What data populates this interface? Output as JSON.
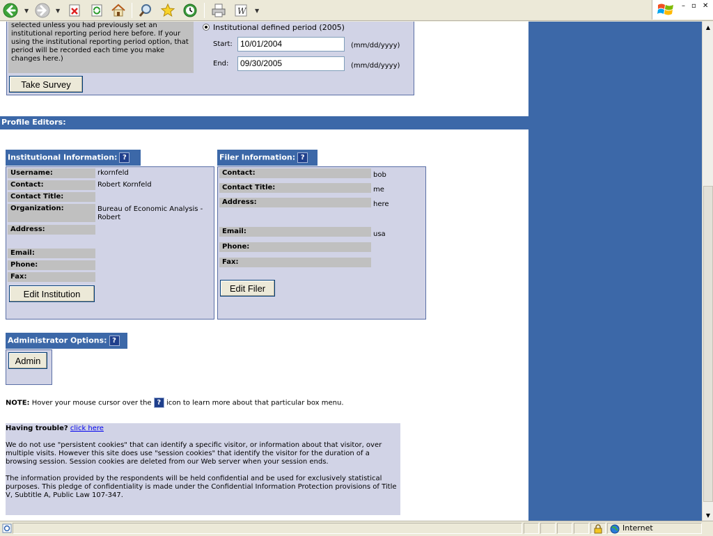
{
  "toolbar": {
    "buttons": [
      "back-icon",
      "forward-icon",
      "stop-icon",
      "refresh-icon",
      "home-icon",
      "search-icon",
      "favorites-icon",
      "history-icon",
      "print-icon",
      "word-icon"
    ],
    "window_controls": {
      "minimize": "–",
      "restore": "▫",
      "close": "✕"
    }
  },
  "survey": {
    "note": "selected unless you had previously set an institutional reporting period here before. If your using the institutional reporting period option, that period will be recorded each time you make changes here.)",
    "radio_label": "Institutional defined period (2005)",
    "start_label": "Start:",
    "start_value": "10/01/2004",
    "end_label": "End:",
    "end_value": "09/30/2005",
    "date_format": "(mm/dd/yyyy)",
    "take_survey_button": "Take Survey"
  },
  "profile_editors": {
    "title": "Profile Editors:"
  },
  "institutional": {
    "title": "Institutional Information:",
    "fields": [
      {
        "label": "Username:",
        "value": "rkornfeld"
      },
      {
        "label": "Contact:",
        "value": "Robert Kornfeld"
      },
      {
        "label": "Contact Title:",
        "value": ""
      },
      {
        "label": "Organization:",
        "value": "Bureau of Economic Analysis - Robert"
      },
      {
        "label": "Address:",
        "value": ""
      },
      {
        "label": "Email:",
        "value": ""
      },
      {
        "label": "Phone:",
        "value": ""
      },
      {
        "label": "Fax:",
        "value": ""
      }
    ],
    "edit_button": "Edit Institution"
  },
  "filer": {
    "title": "Filer Information:",
    "fields": [
      {
        "label": "Contact:",
        "value": "bob"
      },
      {
        "label": "Contact Title:",
        "value": "me"
      },
      {
        "label": "Address:",
        "value": "here"
      },
      {
        "label": "Email:",
        "value": "usa"
      },
      {
        "label": "Phone:",
        "value": ""
      },
      {
        "label": "Fax:",
        "value": ""
      }
    ],
    "edit_button": "Edit Filer"
  },
  "admin": {
    "title": "Administrator Options:",
    "button": "Admin"
  },
  "note": {
    "prefix": "NOTE:",
    "text_before": "Hover your mouse cursor over the",
    "text_after": "icon to learn more about that particular box menu."
  },
  "help_icon_glyph": "?",
  "info": {
    "trouble_label": "Having trouble?",
    "trouble_link": "click here",
    "cookies_text": "We do not use \"persistent cookies\" that can identify a specific visitor, or information about that visitor, over multiple visits. However this site does use \"session cookies\" that identify the visitor for the duration of a browsing session. Session cookies are deleted from our Web server when your session ends.",
    "confidential_text": "The information provided by the respondents will be held confidential and be used for exclusively statistical purposes. This pledge of confidentiality is made under the Confidential Information Protection provisions of Title V, Subtitle A, Public Law 107-347."
  },
  "statusbar": {
    "zone": "Internet"
  },
  "colors": {
    "accent": "#3c68a8",
    "box": "#d1d3e6",
    "label_bg": "#c0c0c0"
  }
}
